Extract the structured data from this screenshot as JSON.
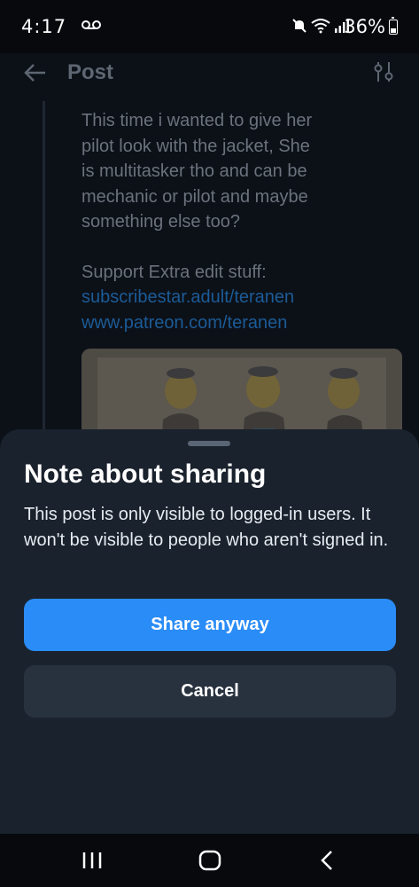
{
  "status_bar": {
    "time": "4:17",
    "battery": "36%",
    "battery_level": 0.36,
    "icons": [
      "voicemail-icon",
      "mute-icon",
      "wifi-icon",
      "signal-icon",
      "battery-icon"
    ]
  },
  "header": {
    "title": "Post",
    "back_icon": "arrow-left-icon",
    "filter_icon": "sliders-icon"
  },
  "post": {
    "text_lines": [
      "This time i wanted to give her",
      "pilot look with the jacket, She",
      "is multitasker tho and can be",
      "mechanic or pilot and maybe",
      "something else too?"
    ],
    "support_label": "Support Extra edit stuff:",
    "links": [
      "subscribestar.adult/teranen",
      "www.patreon.com/teranen"
    ],
    "link_color": "#1c5b97"
  },
  "sheet": {
    "title": "Note about sharing",
    "message": "This post is only visible to logged-in users. It won't be visible to people who aren't signed in.",
    "primary_button": "Share anyway",
    "secondary_button": "Cancel",
    "accent_color": "#2a8cf7"
  },
  "nav_bar": {
    "icons": [
      "recents-icon",
      "home-icon",
      "back-icon"
    ]
  }
}
